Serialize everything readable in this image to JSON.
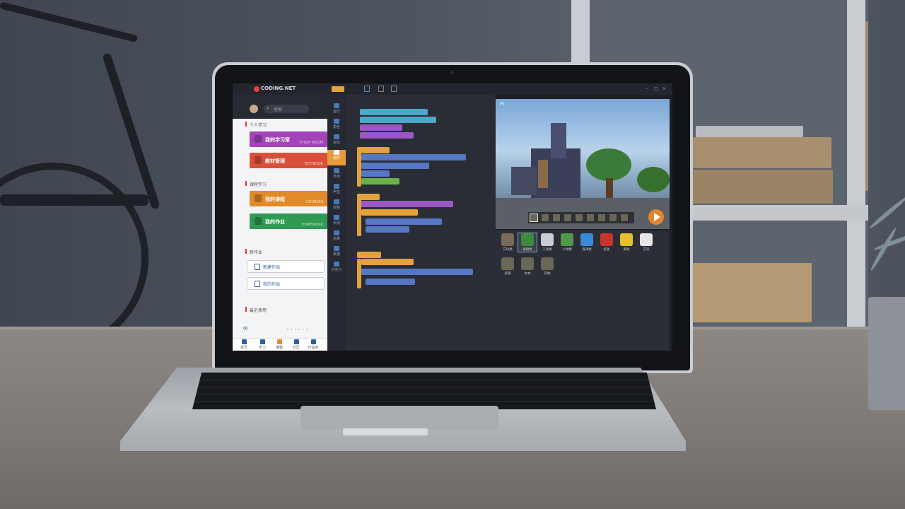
{
  "app": {
    "brand": "CODING.NET",
    "window_controls": [
      "–",
      "□",
      "×"
    ]
  },
  "left_panel": {
    "search_placeholder": "搜索",
    "section_personal": "个人学习",
    "btn_study_room": "我的学习室",
    "btn_study_room_en": "STUDY ROOM",
    "btn_textbook": "教材管理",
    "btn_textbook_en": "TEXTBOOK",
    "section_course": "课程学习",
    "btn_courses": "我的课程",
    "btn_courses_en": "COURSES",
    "btn_homework": "我的作业",
    "btn_homework_en": "HOMEWORK",
    "section_new": "新作业",
    "btn_new_work": "新建作品",
    "btn_my_work": "我的作品",
    "section_recent": "最近使用",
    "nav": [
      {
        "label": "首页"
      },
      {
        "label": "学习"
      },
      {
        "label": "编程"
      },
      {
        "label": "社区"
      },
      {
        "label": "作品库"
      }
    ]
  },
  "rail": {
    "items": [
      "运行",
      "角色",
      "运动",
      "动作",
      "外观",
      "声音",
      "控制",
      "侦测",
      "运算",
      "数据",
      "自定义"
    ]
  },
  "game": {
    "label": "P1"
  },
  "palette": {
    "items": [
      "方块类",
      "植物类",
      "工具类",
      "小动物",
      "海洋类",
      "红色",
      "黄色",
      "方块",
      "背景",
      "文本",
      "其他"
    ]
  },
  "colors": {
    "accent": "#e58c2c",
    "purple_btn": "#a344b8",
    "red_btn": "#d9503a",
    "orange_btn": "#e08a2a",
    "green_btn": "#2e9a52"
  }
}
